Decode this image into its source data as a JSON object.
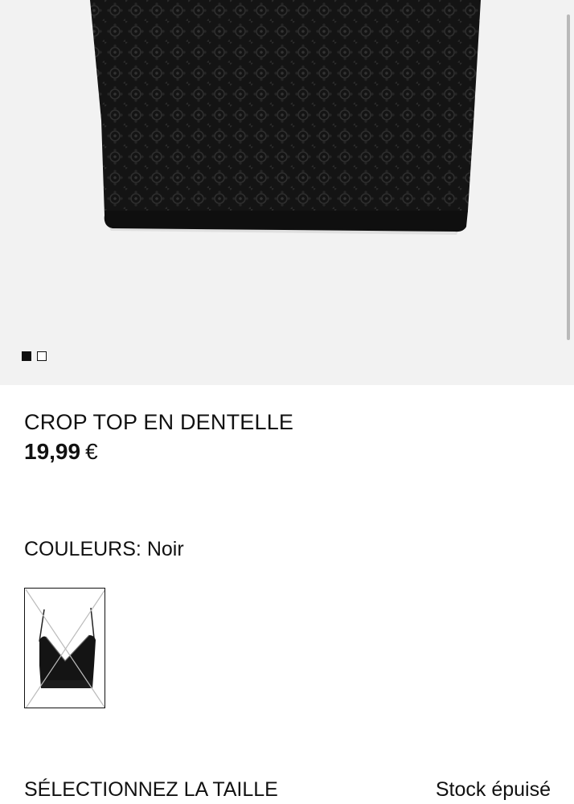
{
  "product": {
    "title": "CROP TOP EN DENTELLE",
    "price_amount": "19,99",
    "price_currency": "€"
  },
  "gallery": {
    "image_count": 2,
    "active_index": 0,
    "background_color": "#f2f2f2",
    "garment_color": "#111111"
  },
  "colors": {
    "label": "COULEURS:",
    "selected": "Noir",
    "swatches": [
      {
        "name": "Noir",
        "state": "unavailable",
        "icon": "crossed-out-swatch"
      }
    ]
  },
  "size": {
    "label": "SÉLECTIONNEZ LA TAILLE",
    "status": "Stock épuisé"
  }
}
